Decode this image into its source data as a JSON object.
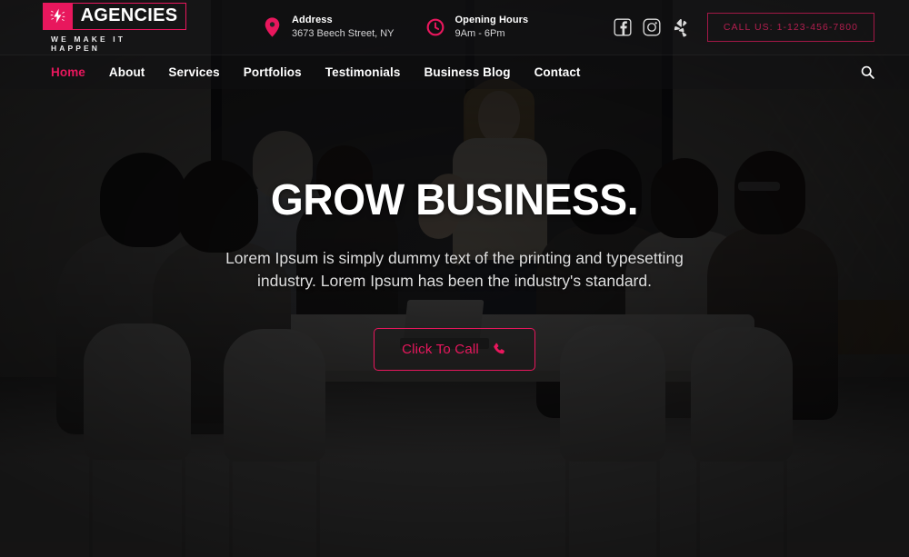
{
  "brand": {
    "name": "AGENCIES",
    "tagline": "WE MAKE IT HAPPEN",
    "accent": "#e8175d",
    "logo_icon": "lightning-bolt-icon"
  },
  "topbar": {
    "address": {
      "icon": "map-pin-icon",
      "title": "Address",
      "value": "3673 Beech Street, NY"
    },
    "hours": {
      "icon": "clock-icon",
      "title": "Opening Hours",
      "value": "9Am - 6Pm"
    },
    "socials": [
      {
        "name": "facebook-icon",
        "label": "Facebook"
      },
      {
        "name": "instagram-icon",
        "label": "Instagram"
      },
      {
        "name": "yelp-icon",
        "label": "Yelp"
      }
    ],
    "call_button": "CALL US: 1-123-456-7800"
  },
  "nav": {
    "items": [
      {
        "label": "Home",
        "active": true
      },
      {
        "label": "About",
        "active": false
      },
      {
        "label": "Services",
        "active": false
      },
      {
        "label": "Portfolios",
        "active": false
      },
      {
        "label": "Testimonials",
        "active": false
      },
      {
        "label": "Business Blog",
        "active": false
      },
      {
        "label": "Contact",
        "active": false
      }
    ],
    "search_icon": "search-icon"
  },
  "hero": {
    "headline": "GROW BUSINESS.",
    "subtext": "Lorem Ipsum is simply dummy text of the printing and typesetting industry. Lorem Ipsum has been the industry's standard.",
    "cta_label": "Click To Call",
    "cta_icon": "phone-icon"
  }
}
